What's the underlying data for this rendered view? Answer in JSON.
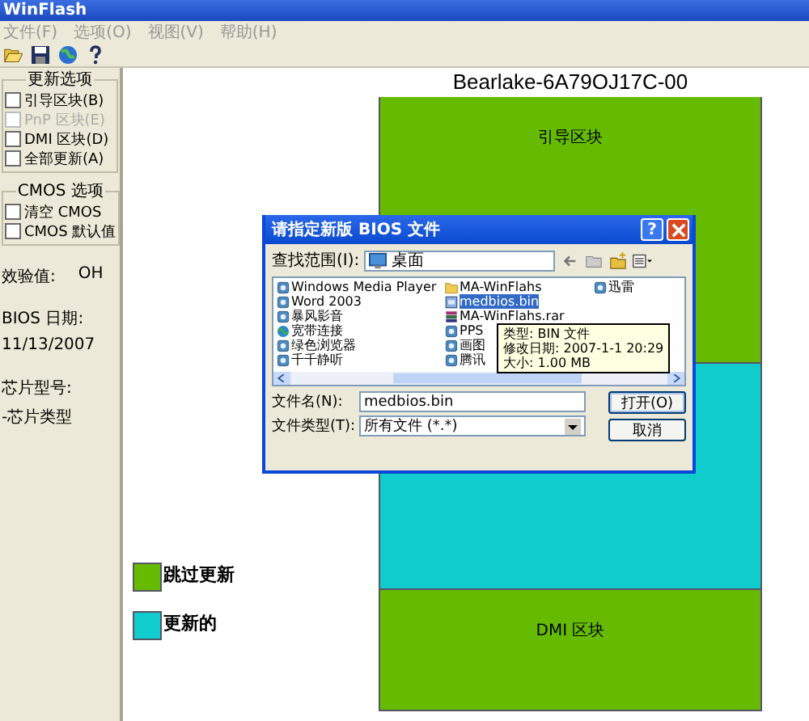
{
  "window": {
    "title": "WinFlash"
  },
  "menu": [
    "文件(F)",
    "选项(O)",
    "视图(V)",
    "帮助(H)"
  ],
  "update_options": {
    "title": "更新选项",
    "items": [
      {
        "label": "引导区块(B)",
        "checked": false,
        "disabled": false
      },
      {
        "label": "PnP 区块(E)",
        "checked": false,
        "disabled": true
      },
      {
        "label": "DMI 区块(D)",
        "checked": false,
        "disabled": false
      },
      {
        "label": "全部更新(A)",
        "checked": false,
        "disabled": false
      }
    ]
  },
  "cmos_options": {
    "title": "CMOS 选项",
    "items": [
      {
        "label": "清空 CMOS",
        "checked": false,
        "disabled": false
      },
      {
        "label": "CMOS 默认值",
        "checked": false,
        "disabled": false
      }
    ]
  },
  "info": [
    {
      "label": "效验值:",
      "value": "OH"
    },
    {
      "label": "BIOS 日期:",
      "value": "11/13/2007"
    },
    {
      "label": "芯片型号:",
      "value": "-芯片类型"
    }
  ],
  "chip_title": "Bearlake-6A79OJ17C-00",
  "blocks": [
    {
      "label": "引导区块",
      "color": "#66bb00"
    },
    {
      "color": "#11cccc"
    },
    {
      "label": "DMI 区块",
      "color": "#66bb00"
    }
  ],
  "legend": [
    {
      "label": "跳过更新",
      "color": "#66bb00"
    },
    {
      "label": "更新的",
      "color": "#11cccc"
    }
  ],
  "dialog": {
    "title": "请指定新版 BIOS 文件",
    "help": "?",
    "look_in": {
      "label": "查找范围(I):",
      "value": "桌面"
    },
    "files": [
      {
        "name": "Windows Media Player",
        "kind": "app",
        "selected": false
      },
      {
        "name": "Word 2003",
        "kind": "app",
        "selected": false
      },
      {
        "name": "暴风影音",
        "kind": "app",
        "selected": false
      },
      {
        "name": "宽带连接",
        "kind": "network",
        "selected": false
      },
      {
        "name": "绿色浏览器",
        "kind": "app",
        "selected": false
      },
      {
        "name": "千千静听",
        "kind": "app",
        "selected": false
      },
      {
        "name": "MA-WinFlahs",
        "kind": "folder",
        "selected": false
      },
      {
        "name": "medbios.bin",
        "kind": "file",
        "selected": true
      },
      {
        "name": "MA-WinFlahs.rar",
        "kind": "archive",
        "selected": false
      },
      {
        "name": "PPS",
        "kind": "app",
        "selected": false
      },
      {
        "name": "画图",
        "kind": "app",
        "selected": false
      },
      {
        "name": "腾讯",
        "kind": "app",
        "selected": false
      },
      {
        "name": "迅雷",
        "kind": "app",
        "selected": false
      }
    ],
    "tooltip": [
      "类型: BIN 文件",
      "修改日期: 2007-1-1 20:29",
      "大小: 1.00 MB"
    ],
    "file_name": {
      "label": "文件名(N):",
      "value": "medbios.bin"
    },
    "file_type": {
      "label": "文件类型(T):",
      "value": "所有文件 (*.*)"
    },
    "buttons": [
      "打开(O)",
      "取消"
    ]
  }
}
